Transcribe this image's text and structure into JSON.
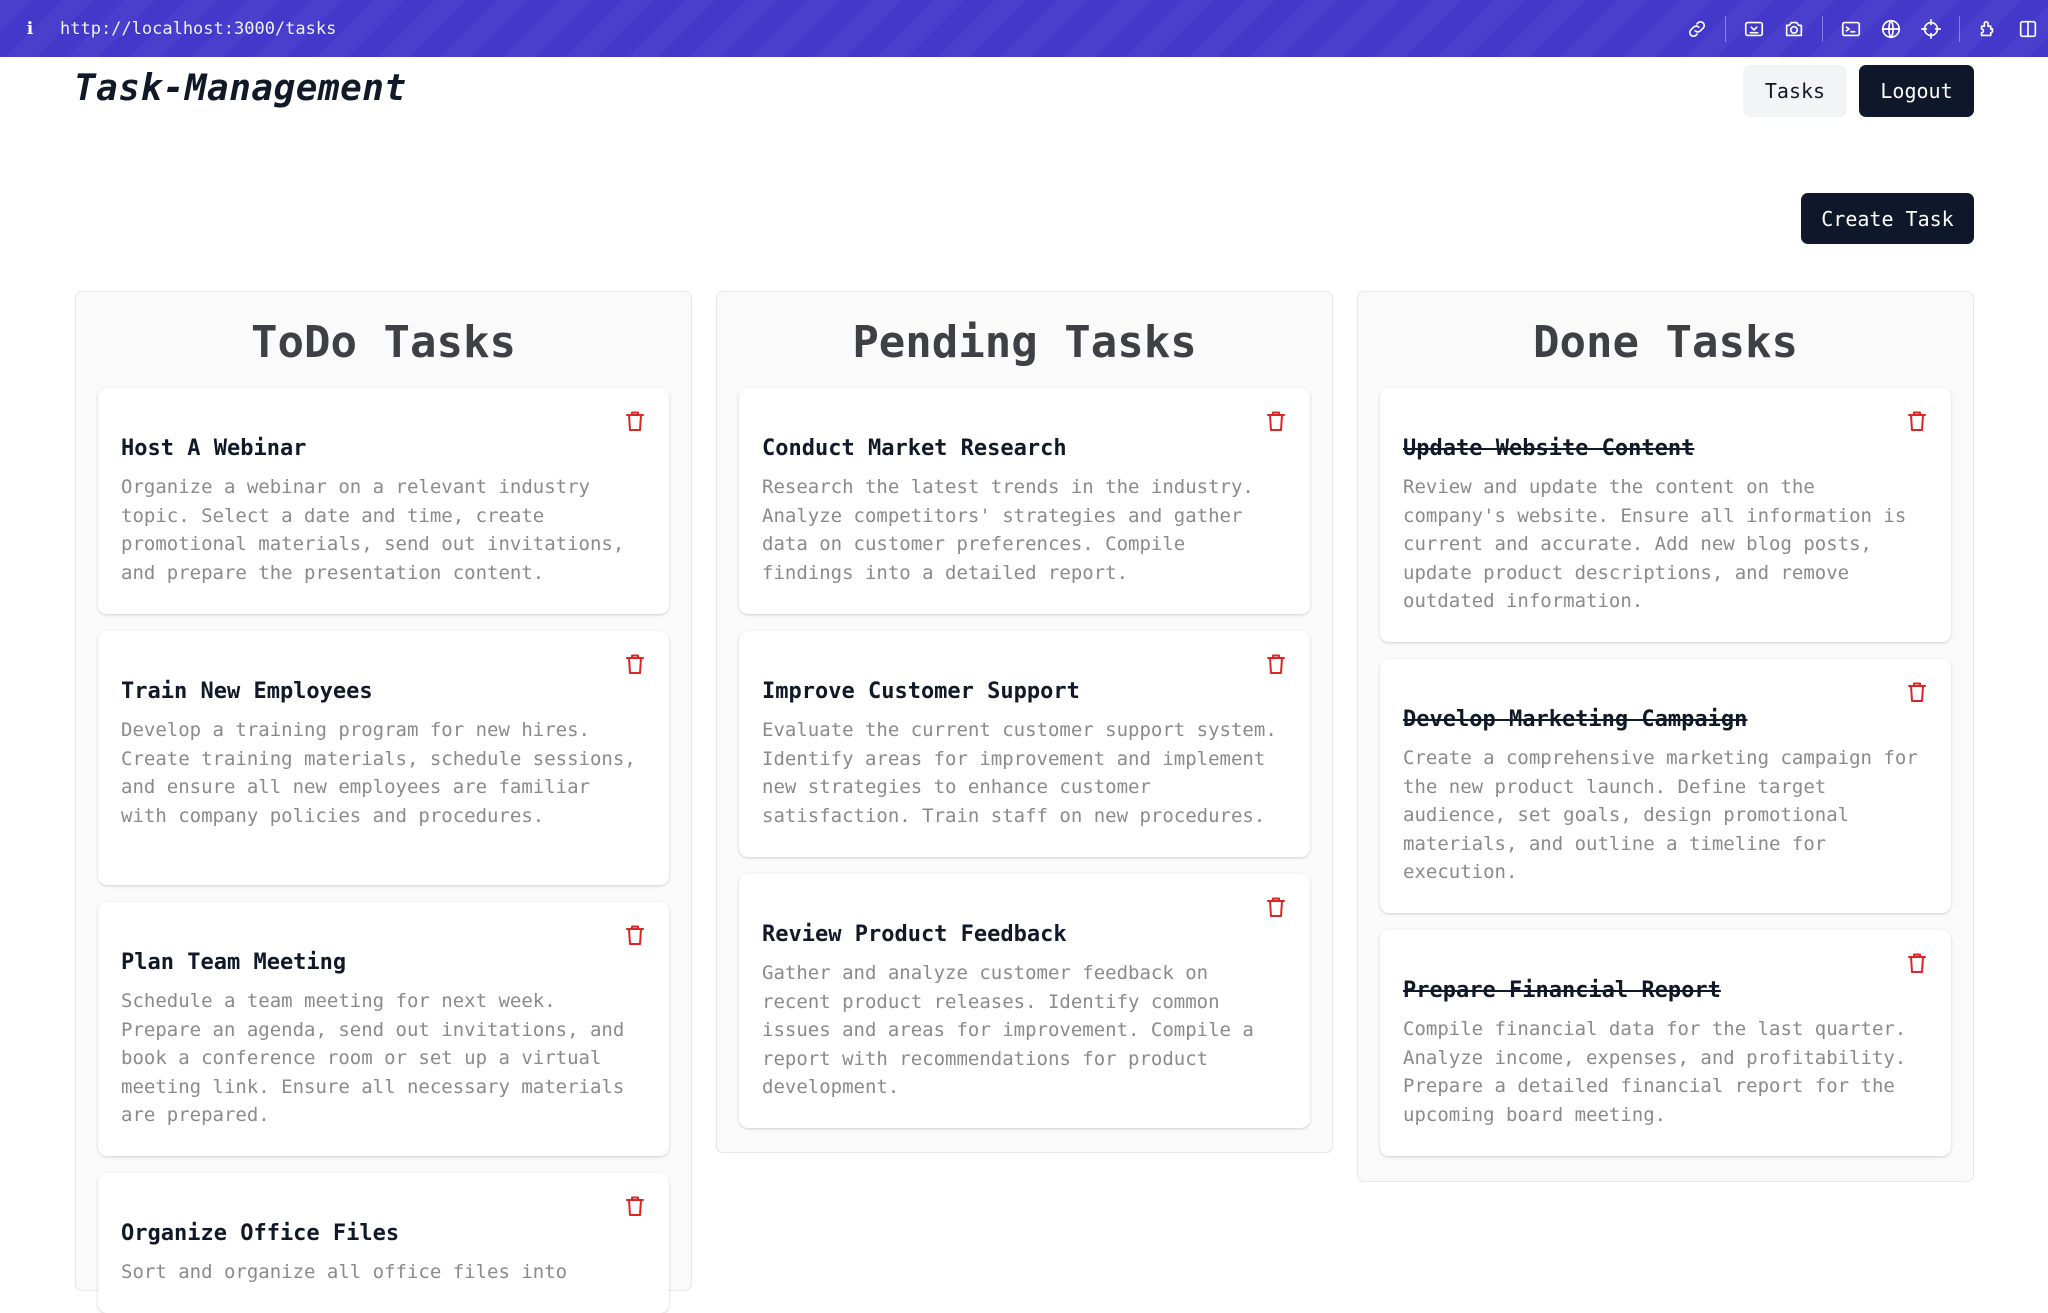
{
  "browser": {
    "info_icon": "i",
    "url": "http://localhost:3000/tasks",
    "icons": [
      "link-icon",
      "inspect-icon",
      "camera-icon",
      "terminal-icon",
      "globe-icon",
      "crosshair-icon",
      "extension-icon",
      "sidebar-icon"
    ]
  },
  "header": {
    "brand": "Task-Management",
    "tasks_label": "Tasks",
    "logout_label": "Logout"
  },
  "toolbar": {
    "create_label": "Create Task"
  },
  "colors": {
    "accent": "#4338ca",
    "primary_button": "#0f172a",
    "delete_icon": "#dc2626"
  },
  "columns": {
    "todo": {
      "title": "ToDo Tasks",
      "tasks": [
        {
          "title": "Host A Webinar",
          "description": "Organize a webinar on a relevant industry topic. Select a date and time, create promotional materials, send out invitations, and prepare the presentation content."
        },
        {
          "title": "Train New Employees",
          "description": "Develop a training program for new hires. Create training materials, schedule sessions, and ensure all new employees are familiar with company policies and procedures."
        },
        {
          "title": "Plan Team Meeting",
          "description": "Schedule a team meeting for next week. Prepare an agenda, send out invitations, and book a conference room or set up a virtual meeting link. Ensure all necessary materials are prepared."
        },
        {
          "title": "Organize Office Files",
          "description": "Sort and organize all office files into"
        }
      ]
    },
    "pending": {
      "title": "Pending Tasks",
      "tasks": [
        {
          "title": "Conduct Market Research",
          "description": "Research the latest trends in the industry. Analyze competitors' strategies and gather data on customer preferences. Compile findings into a detailed report."
        },
        {
          "title": "Improve Customer Support",
          "description": "Evaluate the current customer support system. Identify areas for improvement and implement new strategies to enhance customer satisfaction. Train staff on new procedures."
        },
        {
          "title": "Review Product Feedback",
          "description": "Gather and analyze customer feedback on recent product releases. Identify common issues and areas for improvement. Compile a report with recommendations for product development."
        }
      ]
    },
    "done": {
      "title": "Done Tasks",
      "tasks": [
        {
          "title": "Update Website Content",
          "description": "Review and update the content on the company's website. Ensure all information is current and accurate. Add new blog posts, update product descriptions, and remove outdated information."
        },
        {
          "title": "Develop Marketing Campaign",
          "description": "Create a comprehensive marketing campaign for the new product launch. Define target audience, set goals, design promotional materials, and outline a timeline for execution."
        },
        {
          "title": "Prepare Financial Report",
          "description": "Compile financial data for the last quarter. Analyze income, expenses, and profitability. Prepare a detailed financial report for the upcoming board meeting."
        }
      ]
    }
  }
}
